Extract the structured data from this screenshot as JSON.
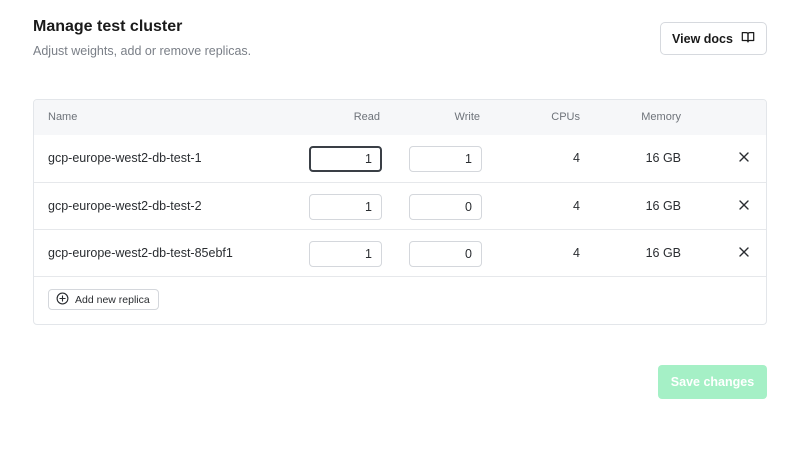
{
  "header": {
    "title": "Manage test cluster",
    "subtitle": "Adjust weights, add or remove replicas.",
    "docs_button_label": "View docs",
    "docs_icon": "book-open-icon"
  },
  "table": {
    "columns": {
      "name": "Name",
      "read": "Read",
      "write": "Write",
      "cpus": "CPUs",
      "memory": "Memory"
    },
    "rows": [
      {
        "name": "gcp-europe-west2-db-test-1",
        "read": "1",
        "write": "1",
        "cpus": "4",
        "memory": "16 GB",
        "read_focused": true
      },
      {
        "name": "gcp-europe-west2-db-test-2",
        "read": "1",
        "write": "0",
        "cpus": "4",
        "memory": "16 GB",
        "read_focused": false
      },
      {
        "name": "gcp-europe-west2-db-test-85ebf1",
        "read": "1",
        "write": "0",
        "cpus": "4",
        "memory": "16 GB",
        "read_focused": false
      }
    ],
    "remove_icon": "close-icon",
    "add_button_label": "Add new replica",
    "add_icon": "plus-circle-icon"
  },
  "footer": {
    "save_button_label": "Save changes",
    "save_button_state": "disabled"
  },
  "colors": {
    "save_button_bg": "#a5f0c6",
    "table_header_bg": "#f6f7f9",
    "border": "#e3e6ea"
  }
}
